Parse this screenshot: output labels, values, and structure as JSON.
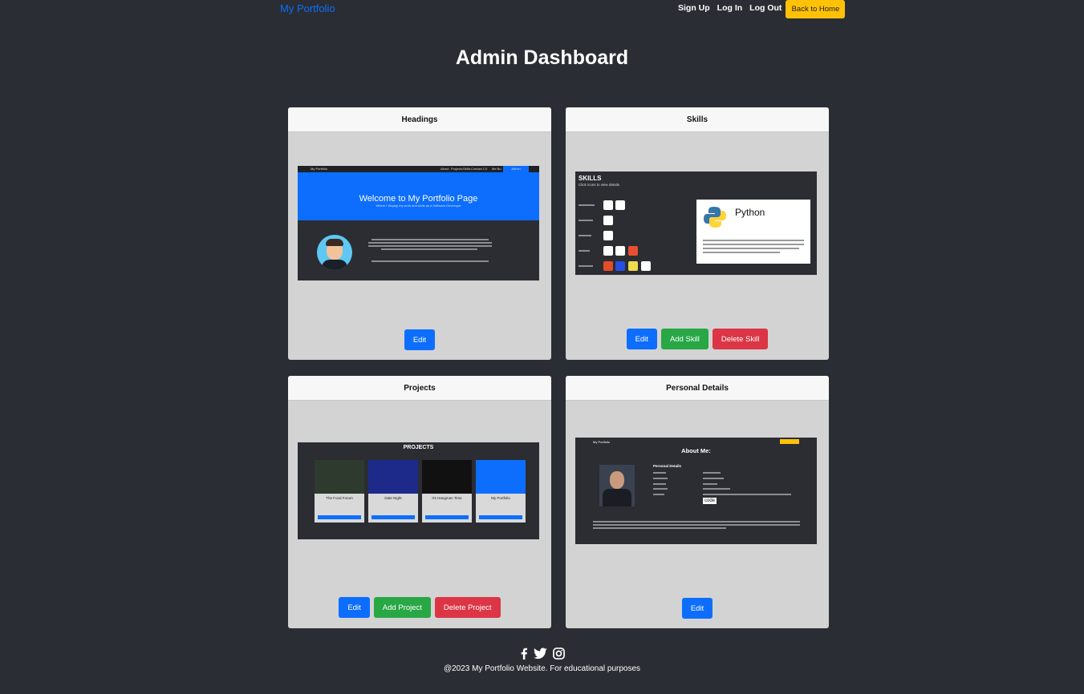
{
  "navbar": {
    "brand": "My Portfolio",
    "links": [
      "Sign Up",
      "Log In",
      "Log Out"
    ],
    "home_button": "Back to Home"
  },
  "page": {
    "title": "Admin Dashboard"
  },
  "cards": {
    "headings": {
      "title": "Headings",
      "buttons": [
        "Edit"
      ],
      "preview": {
        "brand": "My Portfolio",
        "nav": [
          "About",
          "Projects",
          "Skills",
          "Contact",
          "CV",
          "Me Bu"
        ],
        "nav_button": "Admin Dashboard",
        "banner_title": "Welcome to My Portfolio Page",
        "banner_subtitle": "Where I display my work and skills as a Software Developer"
      }
    },
    "skills": {
      "title": "Skills",
      "buttons": [
        "Edit",
        "Add Skill",
        "Delete Skill"
      ],
      "preview": {
        "heading": "SKILLS",
        "subheading": "Click icons to view details",
        "modal_title": "Python"
      }
    },
    "projects": {
      "title": "Projects",
      "buttons": [
        "Edit",
        "Add Project",
        "Delete Project"
      ],
      "preview": {
        "heading": "PROJECTS",
        "items": [
          "The Food Forum",
          "Date Night",
          "It's Hangman Time",
          "My Portfolio"
        ]
      }
    },
    "personal": {
      "title": "Personal Details",
      "buttons": [
        "Edit"
      ],
      "preview": {
        "brand": "My Portfolio",
        "heading": "About Me:",
        "section": "Personal Details",
        "code_badge": "code"
      }
    }
  },
  "footer": {
    "icons": [
      "facebook-icon",
      "twitter-icon",
      "instagram-icon"
    ],
    "copyright": "@2023 My Portfolio Website. For educational purposes"
  },
  "colors": {
    "background": "#2a2d33",
    "brand": "#0d6efd",
    "home_button": "#ffc107",
    "primary": "#0d6efd",
    "success": "#28a745",
    "danger": "#dc3545",
    "card": "#d3d3d3"
  }
}
